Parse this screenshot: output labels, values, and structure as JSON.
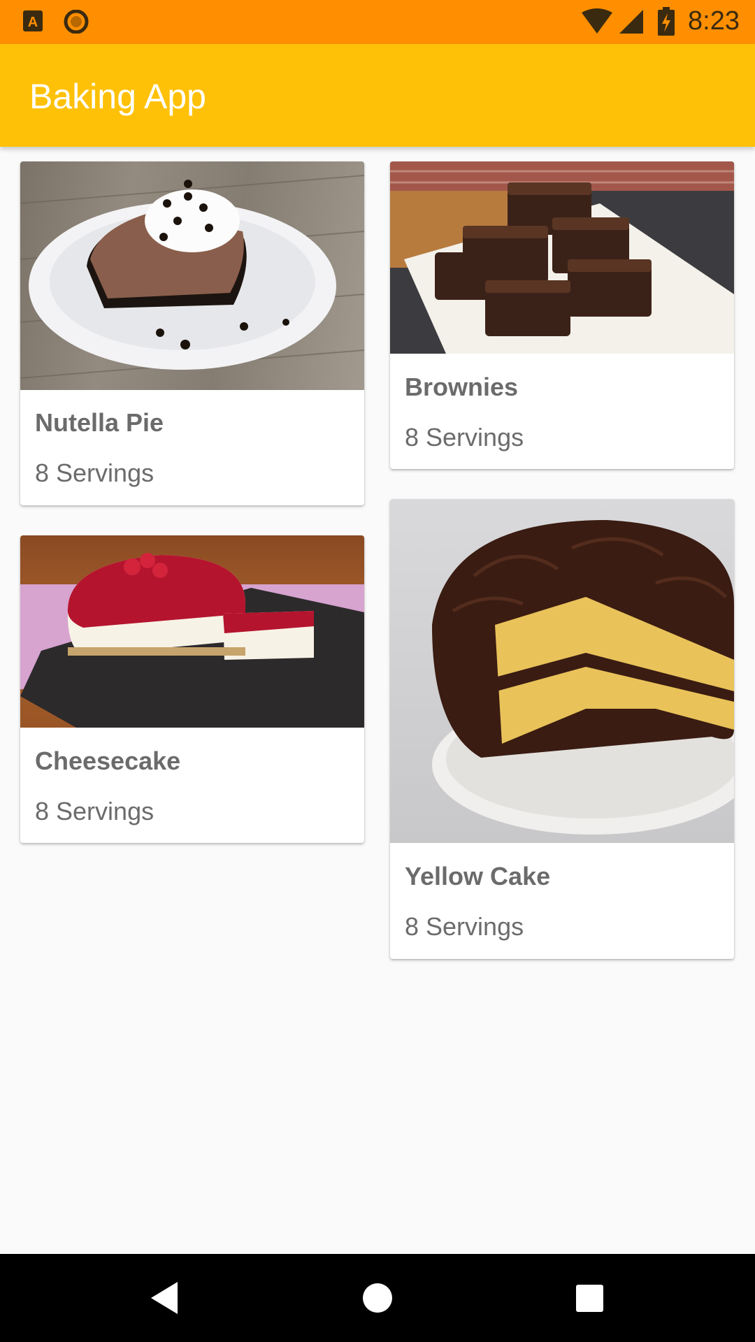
{
  "status_bar": {
    "time": "8:23",
    "icons": [
      "app-a-icon",
      "circle-app-icon",
      "wifi-icon",
      "signal-icon",
      "battery-charging-icon"
    ]
  },
  "app_bar": {
    "title": "Baking App"
  },
  "recipes": [
    {
      "name": "Nutella Pie",
      "servings": "8 Servings",
      "image": "nutella-pie-photo"
    },
    {
      "name": "Brownies",
      "servings": "8 Servings",
      "image": "brownies-photo"
    },
    {
      "name": "Cheesecake",
      "servings": "8 Servings",
      "image": "cheesecake-photo"
    },
    {
      "name": "Yellow Cake",
      "servings": "8 Servings",
      "image": "yellow-cake-photo"
    }
  ],
  "nav_bar": {
    "icons": [
      "back-icon",
      "home-icon",
      "recents-icon"
    ]
  },
  "colors": {
    "status_bar": "#ff8f00",
    "app_bar": "#ffc107",
    "background": "#fafafa"
  }
}
